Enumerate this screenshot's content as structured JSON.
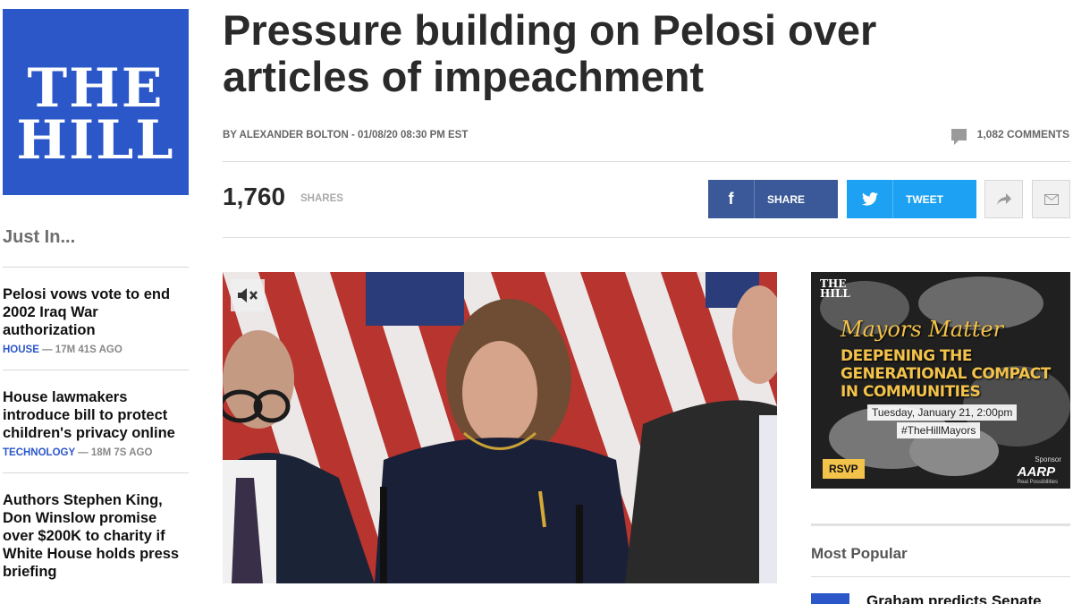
{
  "brand": {
    "logo_line1": "THE",
    "logo_line2": "HILL",
    "color": "#2b57c9"
  },
  "sidebar": {
    "heading": "Just In...",
    "items": [
      {
        "title": "Pelosi vows vote to end 2002 Iraq War authorization",
        "category": "HOUSE",
        "time": " — 17M 41S AGO"
      },
      {
        "title": "House lawmakers introduce bill to protect children's privacy online",
        "category": "TECHNOLOGY",
        "time": " — 18M 7S AGO"
      },
      {
        "title": "Authors Stephen King, Don Winslow promise over $200K to charity if White House holds press briefing",
        "category": "",
        "time": ""
      }
    ]
  },
  "article": {
    "headline": "Pressure building on Pelosi over articles of impeachment",
    "byline": "BY ALEXANDER BOLTON - 01/08/20 08:30 PM EST",
    "comments": "1,082 COMMENTS",
    "shares_count": "1,760",
    "shares_label": "SHARES"
  },
  "share_buttons": {
    "facebook_label": "SHARE",
    "twitter_label": "TWEET",
    "facebook_color": "#3b5998",
    "twitter_color": "#1da1f2"
  },
  "ad": {
    "logo_line1": "THE",
    "logo_line2": "HILL",
    "title": "Mayors Matter",
    "subtitle": "DEEPENING THE GENERATIONAL COMPACT IN COMMUNITIES",
    "date": "Tuesday, January 21, 2:00pm",
    "hashtag": "#TheHillMayors",
    "rsvp": "RSVP",
    "sponsor_label": "Sponsor",
    "sponsor_name": "AARP",
    "sponsor_tagline": "Real Possibilities"
  },
  "most_popular": {
    "heading": "Most Popular",
    "first_title": "Graham predicts Senate"
  }
}
